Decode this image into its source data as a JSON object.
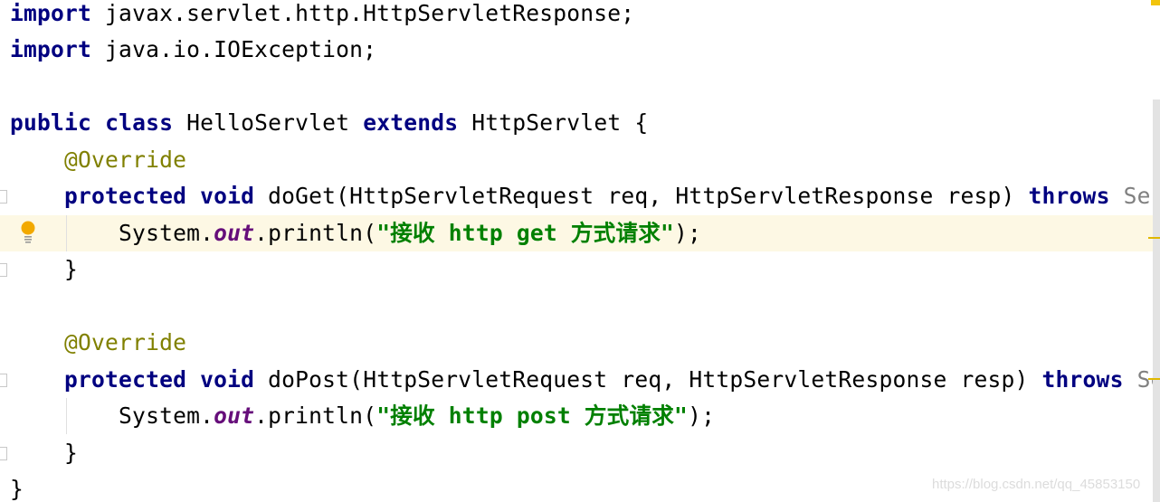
{
  "editor": {
    "caret_line": 6,
    "colors": {
      "keyword": "#000080",
      "annotation": "#808000",
      "string": "#008000",
      "field": "#660e7a",
      "caret_row": "#fdf8e4"
    },
    "lines": [
      [
        [
          "import",
          "kw"
        ],
        [
          " javax.servlet.http.HttpServletResponse;",
          ""
        ]
      ],
      [
        [
          "import",
          "kw"
        ],
        [
          " java.io.IOException;",
          ""
        ]
      ],
      [],
      [
        [
          "public",
          "kw"
        ],
        [
          " ",
          ""
        ],
        [
          "class",
          "kw"
        ],
        [
          " HelloServlet ",
          ""
        ],
        [
          "extends",
          "kw"
        ],
        [
          " HttpServlet {",
          ""
        ]
      ],
      [
        [
          "    ",
          ""
        ],
        [
          "@Override",
          "ann"
        ]
      ],
      [
        [
          "    ",
          ""
        ],
        [
          "protected",
          "kw"
        ],
        [
          " ",
          ""
        ],
        [
          "void",
          "kw"
        ],
        [
          " doGet(HttpServletRequest req, HttpServletResponse resp) ",
          ""
        ],
        [
          "throws",
          "kw"
        ],
        [
          " Ser",
          "dim"
        ]
      ],
      [
        [
          "        System.",
          ""
        ],
        [
          "out",
          "fld"
        ],
        [
          ".println(",
          ""
        ],
        [
          "\"接收 http get 方式请求\"",
          "str"
        ],
        [
          ");",
          ""
        ]
      ],
      [
        [
          "    }",
          ""
        ]
      ],
      [],
      [
        [
          "    ",
          ""
        ],
        [
          "@Override",
          "ann"
        ]
      ],
      [
        [
          "    ",
          ""
        ],
        [
          "protected",
          "kw"
        ],
        [
          " ",
          ""
        ],
        [
          "void",
          "kw"
        ],
        [
          " doPost(HttpServletRequest req, HttpServletResponse resp) ",
          ""
        ],
        [
          "throws",
          "kw"
        ],
        [
          " Se",
          "dim"
        ]
      ],
      [
        [
          "        System.",
          ""
        ],
        [
          "out",
          "fld"
        ],
        [
          ".println(",
          ""
        ],
        [
          "\"接收 http post 方式请求\"",
          "str"
        ],
        [
          ");",
          ""
        ]
      ],
      [
        [
          "    }",
          ""
        ]
      ],
      [
        [
          "}",
          ""
        ]
      ]
    ],
    "fold_lines": [
      5,
      7,
      10,
      12
    ],
    "guide_lines": [
      6,
      11
    ],
    "bulb_line": 6
  },
  "watermark": "https://blog.csdn.net/qq_45853150"
}
